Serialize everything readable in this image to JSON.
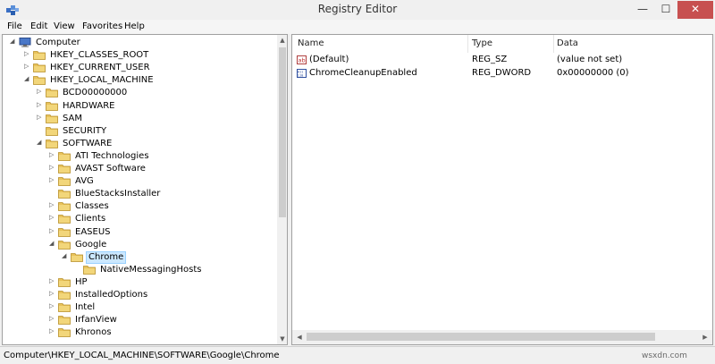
{
  "window": {
    "title": "Registry Editor",
    "min": "—",
    "max": "☐",
    "close": "✕"
  },
  "menu": [
    "File",
    "Edit",
    "View",
    "Favorites",
    "Help"
  ],
  "tree": [
    {
      "label": "Computer",
      "arrow": "◢",
      "type": "computer"
    },
    {
      "label": "HKEY_CLASSES_ROOT",
      "arrow": "▷"
    },
    {
      "label": "HKEY_CURRENT_USER",
      "arrow": "▷"
    },
    {
      "label": "HKEY_LOCAL_MACHINE",
      "arrow": "◢"
    },
    {
      "label": "BCD00000000",
      "arrow": "▷"
    },
    {
      "label": "HARDWARE",
      "arrow": "▷"
    },
    {
      "label": "SAM",
      "arrow": "▷"
    },
    {
      "label": "SECURITY",
      "arrow": ""
    },
    {
      "label": "SOFTWARE",
      "arrow": "◢"
    },
    {
      "label": "ATI Technologies",
      "arrow": "▷"
    },
    {
      "label": "AVAST Software",
      "arrow": "▷"
    },
    {
      "label": "AVG",
      "arrow": "▷"
    },
    {
      "label": "BlueStacksInstaller",
      "arrow": ""
    },
    {
      "label": "Classes",
      "arrow": "▷"
    },
    {
      "label": "Clients",
      "arrow": "▷"
    },
    {
      "label": "EASEUS",
      "arrow": "▷"
    },
    {
      "label": "Google",
      "arrow": "◢"
    },
    {
      "label": "Chrome",
      "arrow": "◢",
      "selected": true
    },
    {
      "label": "NativeMessagingHosts",
      "arrow": ""
    },
    {
      "label": "HP",
      "arrow": "▷"
    },
    {
      "label": "InstalledOptions",
      "arrow": "▷"
    },
    {
      "label": "Intel",
      "arrow": "▷"
    },
    {
      "label": "IrfanView",
      "arrow": "▷"
    },
    {
      "label": "Khronos",
      "arrow": "▷"
    }
  ],
  "columns": {
    "name": "Name",
    "type": "Type",
    "data": "Data"
  },
  "values": [
    {
      "icon": "ab",
      "name": "(Default)",
      "type": "REG_SZ",
      "data": "(value not set)"
    },
    {
      "icon": "dword",
      "name": "ChromeCleanupEnabled",
      "type": "REG_DWORD",
      "data": "0x00000000 (0)"
    }
  ],
  "status": {
    "path": "Computer\\HKEY_LOCAL_MACHINE\\SOFTWARE\\Google\\Chrome"
  },
  "watermark": "wsxdn.com",
  "colors": {
    "folder": "#e8c25a",
    "selected_bg": "#cce8ff",
    "close_btn": "#c75050"
  }
}
